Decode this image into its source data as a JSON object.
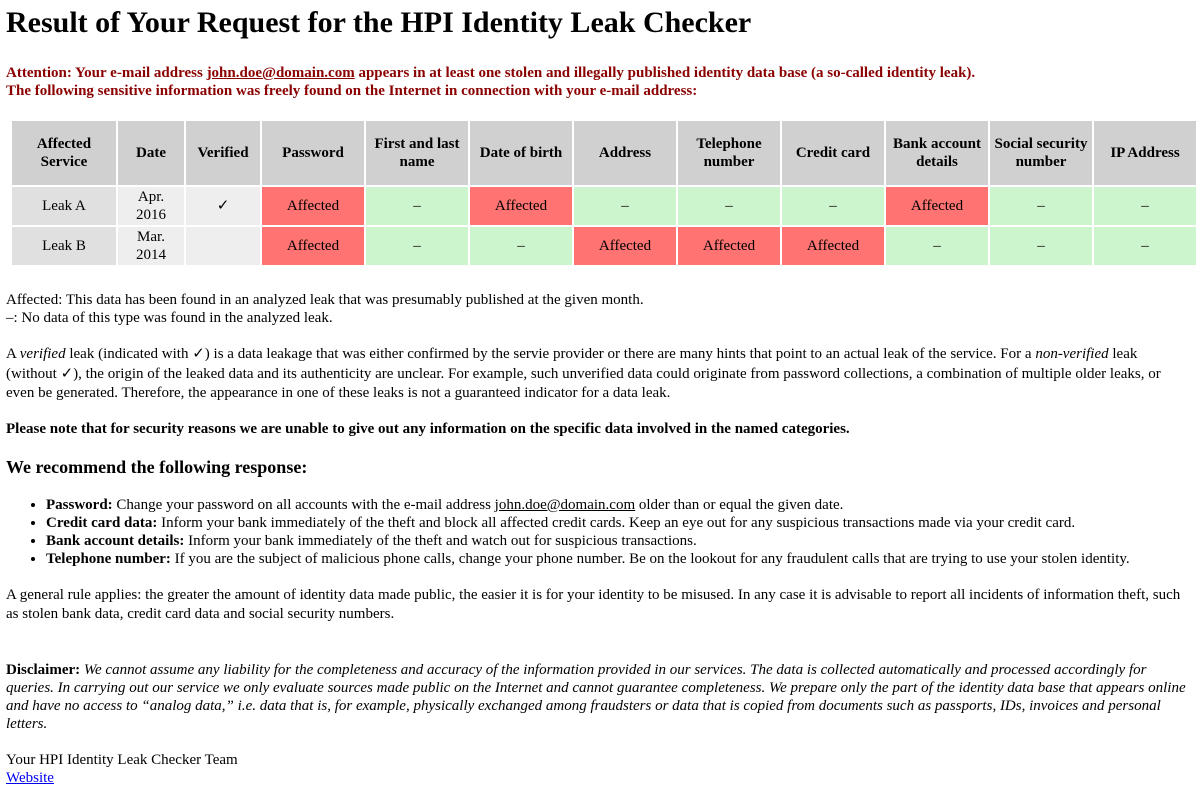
{
  "title": "Result of Your Request for the HPI Identity Leak Checker",
  "attention": {
    "line1_prefix": "Attention: Your e-mail address ",
    "email": "john.doe@domain.com",
    "line1_suffix": " appears in at least one stolen and illegally published identity data base (a so-called identity leak).",
    "line2": "The following sensitive information was freely found on the Internet in connection with your e-mail address:"
  },
  "table": {
    "headers": [
      "Affected Service",
      "Date",
      "Verified",
      "Password",
      "First and last name",
      "Date of birth",
      "Address",
      "Telephone number",
      "Credit card",
      "Bank account details",
      "Social security number",
      "IP Address"
    ],
    "rows": [
      {
        "service": "Leak A",
        "date_month": "Apr.",
        "date_year": "2016",
        "verified": "✓",
        "cells": [
          "Affected",
          "–",
          "Affected",
          "–",
          "–",
          "–",
          "Affected",
          "–",
          "–"
        ],
        "status": [
          "affected",
          "clean",
          "affected",
          "clean",
          "clean",
          "clean",
          "affected",
          "clean",
          "clean"
        ]
      },
      {
        "service": "Leak B",
        "date_month": "Mar.",
        "date_year": "2014",
        "verified": "",
        "cells": [
          "Affected",
          "–",
          "–",
          "Affected",
          "Affected",
          "Affected",
          "–",
          "–",
          "–"
        ],
        "status": [
          "affected",
          "clean",
          "clean",
          "affected",
          "affected",
          "affected",
          "clean",
          "clean",
          "clean"
        ]
      }
    ],
    "colors": {
      "header_bg": "#d0d0d0",
      "service_bg": "#e0e0e0",
      "date_bg": "#eeeeee",
      "affected_bg": "#ff7373",
      "clean_bg": "#cdf5cd"
    }
  },
  "legend": {
    "affected": "Affected: This data has been found in an analyzed leak that was presumably published at the given month.",
    "none": "–: No data of this type was found in the analyzed leak."
  },
  "verified_paragraph": {
    "p1": "A ",
    "verified_word": "verified",
    "p2": " leak (indicated with ✓) is a data leakage that was either confirmed by the servie provider or there are many hints that point to an actual leak of the service. For a ",
    "non_verified_word": "non-verified",
    "p3": " leak (without ✓), the origin of the leaked data and its authenticity are unclear. For example, such unverified data could originate from password collections, a combination of multiple older leaks, or even be generated. Therefore, the appearance in one of these leaks is not a guaranteed indicator for a data leak."
  },
  "security_note": "Please note that for security reasons we are unable to give out any information on the specific data involved in the named categories.",
  "recommend_heading": "We recommend the following response:",
  "recommendations": [
    {
      "label": "Password:",
      "text_before": " Change your password on all accounts with the e-mail address ",
      "email": "john.doe@domain.com",
      "text_after": " older than or equal the given date."
    },
    {
      "label": "Credit card data:",
      "text": " Inform your bank immediately of the theft and block all affected credit cards. Keep an eye out for any suspicious transactions made via your credit card."
    },
    {
      "label": "Bank account details:",
      "text": " Inform your bank immediately of the theft and watch out for suspicious transactions."
    },
    {
      "label": "Telephone number:",
      "text": " If you are the subject of malicious phone calls, change your phone number. Be on the lookout for any fraudulent calls that are trying to use your stolen identity."
    }
  ],
  "general_rule": "A general rule applies: the greater the amount of identity data made public, the easier it is for your identity to be misused. In any case it is advisable to report all incidents of information theft, such as stolen bank data, credit card data and social security numbers.",
  "disclaimer": {
    "label": "Disclaimer:",
    "text": " We cannot assume any liability for the completeness and accuracy of the information provided in our services. The data is collected automatically and processed accordingly for queries. In carrying out our service we only evaluate sources made public on the Internet and cannot guarantee completeness. We prepare only the part of the identity data base that appears online and have no access to “analog data,” i.e. data that is, for example, physically exchanged among fraudsters or data that is copied from documents such as passports, IDs, invoices and personal letters."
  },
  "signature": "Your HPI Identity Leak Checker Team",
  "website_link": "Website"
}
